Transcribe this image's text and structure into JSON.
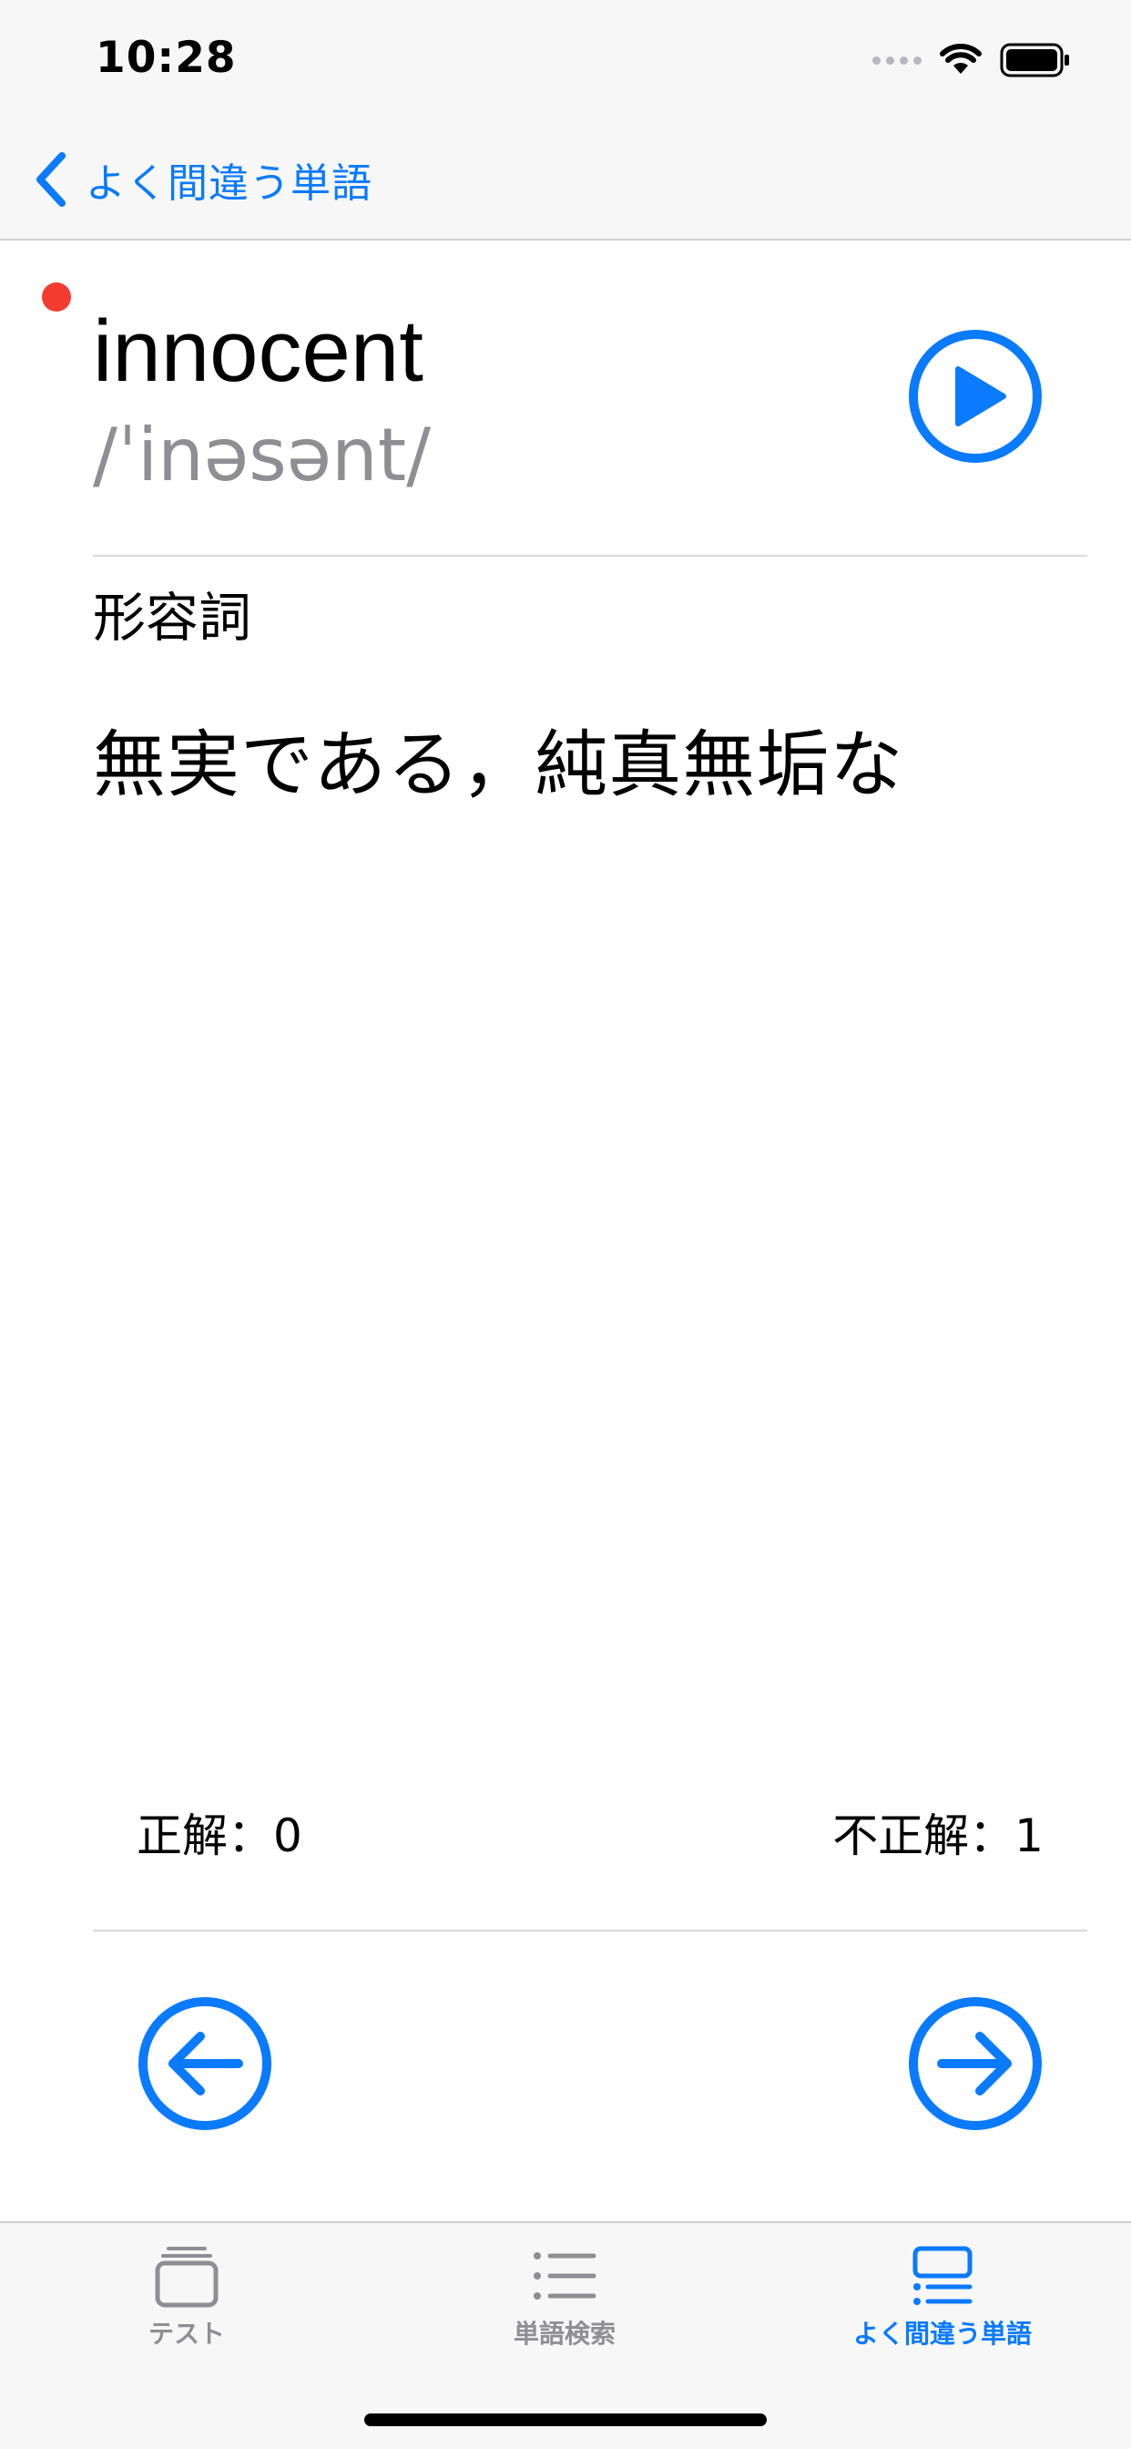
{
  "status_bar": {
    "time": "10:28",
    "icons": [
      "signal-icon",
      "wifi-icon",
      "battery-icon"
    ]
  },
  "nav": {
    "back_label": "よく間違う単語",
    "back_icon": "chevron-left-icon"
  },
  "word": {
    "term": "innocent",
    "pronunciation": "/ˈinəsənt/",
    "part_of_speech": "形容詞",
    "meaning": "無実である，純真無垢な",
    "unread_indicator_color": "#f33b30",
    "play_icon": "play-circle-icon"
  },
  "stats": {
    "correct": "正解：0",
    "incorrect": "不正解：1"
  },
  "navigation_buttons": {
    "prev_icon": "arrow-left-circle-icon",
    "next_icon": "arrow-right-circle-icon"
  },
  "tabs": [
    {
      "label": "テスト",
      "icon": "cards-stack-icon",
      "active": false
    },
    {
      "label": "単語検索",
      "icon": "list-icon",
      "active": false
    },
    {
      "label": "よく間違う単語",
      "icon": "list-card-icon",
      "active": true
    }
  ],
  "colors": {
    "accent": "#0a7aff",
    "secondary_text": "#8e8e93",
    "bar_background": "#f7f7f7",
    "alert_red": "#f33b30"
  }
}
